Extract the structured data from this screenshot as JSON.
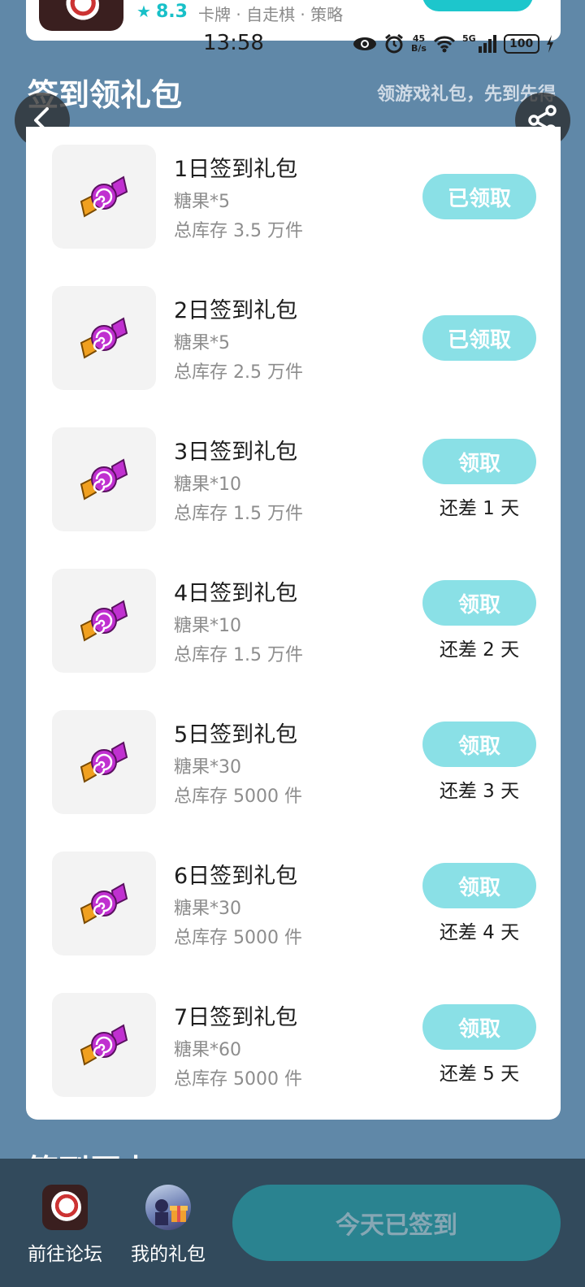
{
  "top_card": {
    "rating": "8.3",
    "tags": "卡牌 · 自走棋 · 策略"
  },
  "status_bar": {
    "time": "13:58",
    "speed_value": "45",
    "speed_unit": "B/s",
    "network": "5G",
    "battery": "100"
  },
  "header": {
    "title": "签到领礼包",
    "subtitle": "领游戏礼包，先到先得"
  },
  "gifts": [
    {
      "title": "1日签到礼包",
      "item": "糖果*5",
      "stock": "总库存 3.5 万件",
      "button": "已领取",
      "remain": ""
    },
    {
      "title": "2日签到礼包",
      "item": "糖果*5",
      "stock": "总库存 2.5 万件",
      "button": "已领取",
      "remain": ""
    },
    {
      "title": "3日签到礼包",
      "item": "糖果*10",
      "stock": "总库存 1.5 万件",
      "button": "领取",
      "remain": "还差 1 天"
    },
    {
      "title": "4日签到礼包",
      "item": "糖果*10",
      "stock": "总库存 1.5 万件",
      "button": "领取",
      "remain": "还差 2 天"
    },
    {
      "title": "5日签到礼包",
      "item": "糖果*30",
      "stock": "总库存 5000 件",
      "button": "领取",
      "remain": "还差 3 天"
    },
    {
      "title": "6日签到礼包",
      "item": "糖果*30",
      "stock": "总库存 5000 件",
      "button": "领取",
      "remain": "还差 4 天"
    },
    {
      "title": "7日签到礼包",
      "item": "糖果*60",
      "stock": "总库存 5000 件",
      "button": "领取",
      "remain": "还差 5 天"
    }
  ],
  "peek_section_title": "签到历史",
  "bottom_bar": {
    "forum_label": "前往论坛",
    "my_gift_label": "我的礼包",
    "checkin_label": "今天已签到"
  },
  "colors": {
    "background": "#6088a8",
    "accent": "#1dc6cc",
    "button_light": "#8ae0e6",
    "checkin_button": "#2a8390"
  }
}
